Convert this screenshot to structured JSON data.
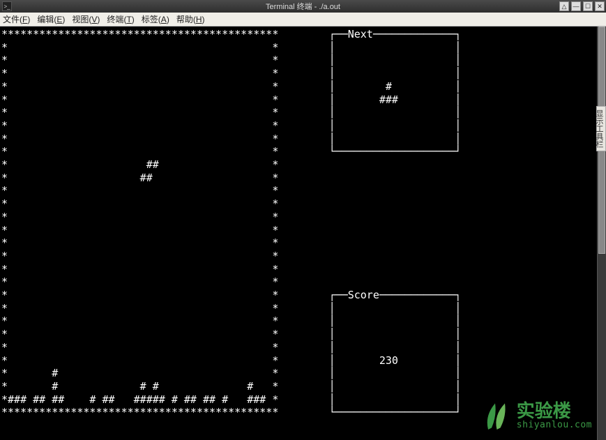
{
  "window": {
    "title": "Terminal 终端 - ./a.out"
  },
  "menu": {
    "file": {
      "label": "文件",
      "accel": "F"
    },
    "edit": {
      "label": "编辑",
      "accel": "E"
    },
    "view": {
      "label": "视图",
      "accel": "V"
    },
    "term": {
      "label": "终端",
      "accel": "T"
    },
    "tabs": {
      "label": "标签",
      "accel": "A"
    },
    "help": {
      "label": "帮助",
      "accel": "H"
    }
  },
  "side_tab_label": "显示工具栏",
  "watermark": {
    "cn": "实验楼",
    "en": "shiyanlou.com"
  },
  "game": {
    "board_width_cols": 44,
    "board_height_rows": 30,
    "falling_piece": {
      "shape": "S",
      "cells": [
        [
          10,
          23
        ],
        [
          10,
          24
        ],
        [
          11,
          22
        ],
        [
          11,
          23
        ]
      ]
    },
    "locked_rows_ascii": [
      "*       #                                  *",
      "*       #             # #              #   *",
      "*### ## ##    # ##   ##### # ## ## #   ### *"
    ],
    "next_panel": {
      "label": "Next",
      "piece": "T",
      "ascii": [
        "  #  ",
        " ### "
      ]
    },
    "score_panel": {
      "label": "Score",
      "value": 230
    }
  },
  "terminal_text": "********************************************        ┌──Next─────────────┐\n*                                          *        │                   │\n*                                          *        │                   │\n*                                          *        │                   │\n*                                          *        │        #          │\n*                                          *        │       ###         │\n*                                          *        │                   │\n*                                          *        │                   │\n*                                          *        │                   │\n*                                          *        └───────────────────┘\n*                      ##                  *\n*                     ##                   *\n*                                          *\n*                                          *\n*                                          *\n*                                          *\n*                                          *\n*                                          *\n*                                          *\n*                                          *\n*                                          *        ┌──Score────────────┐\n*                                          *        │                   │\n*                                          *        │                   │\n*                                          *        │                   │\n*                                          *        │                   │\n*                                          *        │       230         │\n*       #                                  *        │                   │\n*       #             # #              #   *        │                   │\n*### ## ##    # ##   ##### # ## ## #   ### *        │                   │\n********************************************        └───────────────────┘\n"
}
